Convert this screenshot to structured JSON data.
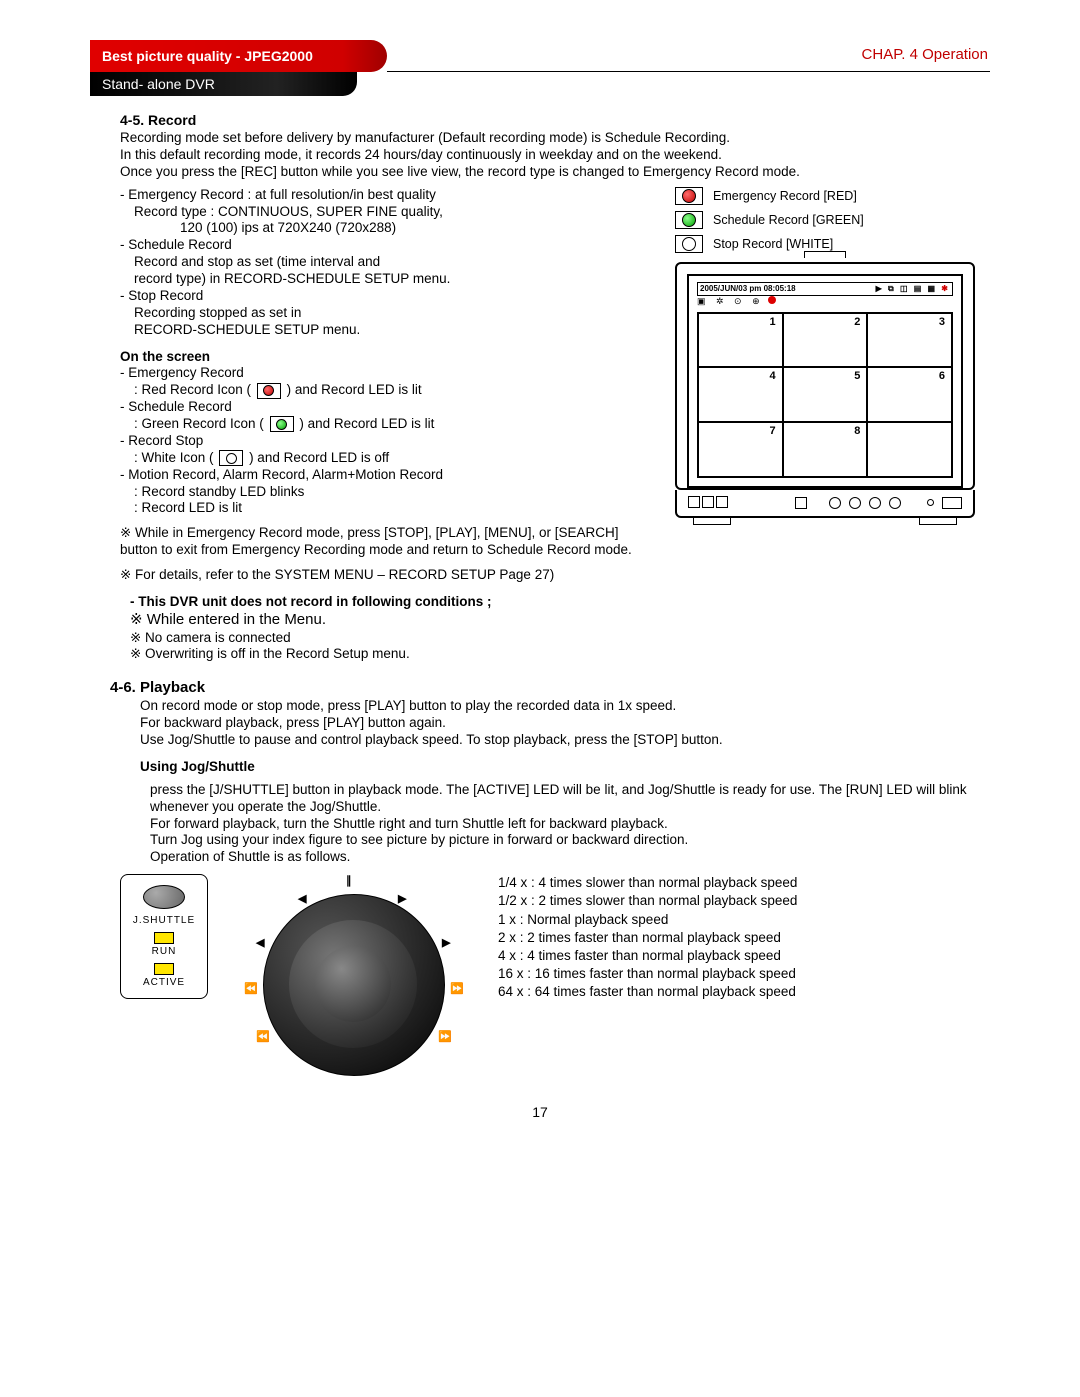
{
  "header": {
    "pill": "Best picture quality - JPEG2000",
    "chapter": "CHAP. 4  Operation",
    "sub": "Stand- alone DVR"
  },
  "s45": {
    "title": "4-5. Record",
    "intro": "Recording mode set before delivery by manufacturer (Default recording mode) is Schedule Recording.\nIn this default recording mode, it records 24 hours/day continuously in weekday and on the weekend.\nOnce you press the [REC] button while you see live view, the record type is changed to Emergency Record mode.",
    "bullets": {
      "b1a": "- Emergency Record : at full resolution/in best quality",
      "b1b": "Record type : CONTINUOUS, SUPER FINE quality,",
      "b1c": "120 (100) ips at 720X240 (720x288)",
      "b2a": "- Schedule Record",
      "b2b": "Record and stop as set (time interval and",
      "b2c": "record type) in RECORD-SCHEDULE SETUP  menu.",
      "b3a": "- Stop Record",
      "b3b": "Recording stopped as set in",
      "b3c": "RECORD-SCHEDULE SETUP menu."
    },
    "onscreen_title": "On the screen",
    "onscreen": {
      "l1": "- Emergency Record",
      "l1b_pre": ": Red Record Icon (",
      "l1b_post": ") and Record LED is lit",
      "l2": "- Schedule Record",
      "l2b_pre": ": Green Record Icon (",
      "l2b_post": ") and Record LED is lit",
      "l3": "- Record Stop",
      "l3b_pre": ": White Icon (",
      "l3b_post": ") and Record LED is off",
      "l4": "- Motion Record, Alarm Record, Alarm+Motion Record",
      "l4b": ": Record standby LED blinks",
      "l4c": ": Record LED is lit",
      "n1": "※ While in Emergency Record mode, press [STOP], [PLAY], [MENU], or [SEARCH] button to exit from Emergency Recording mode and return to Schedule Record mode.",
      "n2": "※ For details, refer to the SYSTEM MENU – RECORD SETUP Page 27)"
    },
    "legend": {
      "red": "Emergency Record [RED]",
      "green": "Schedule Record [GREEN]",
      "white": "Stop Record [WHITE]"
    },
    "osd_time": "2005/JUN/03 pm 08:05:18",
    "grid": [
      "1",
      "2",
      "3",
      "4",
      "5",
      "6",
      "7",
      "8",
      ""
    ],
    "not_record_title": "- This DVR unit does not record in following conditions ;",
    "nr1": "※ While entered in the Menu.",
    "nr2": "※ No camera is connected",
    "nr3": "※ Overwriting is off in the Record Setup menu."
  },
  "s46": {
    "title": "4-6. Playback",
    "intro": "On record mode or stop mode, press [PLAY] button to play the recorded data in 1x speed.\nFor backward playback, press [PLAY] button again.\nUse Jog/Shuttle to pause and control playback speed.  To stop playback, press the [STOP] button.",
    "jog_title": "Using Jog/Shuttle",
    "jog_body": "press the [J/SHUTTLE] button in playback mode. The [ACTIVE] LED will be lit, and Jog/Shuttle is ready for use.  The [RUN] LED will blink whenever you operate the Jog/Shuttle.\nFor forward playback, turn the Shuttle right and turn Shuttle left for backward playback.\nTurn Jog using your index figure to see picture by picture in forward or backward direction.\nOperation of Shuttle is as follows.",
    "jshuttle_label": "J.SHUTTLE",
    "run_label": "RUN",
    "active_label": "ACTIVE",
    "speeds": [
      "1/4 x : 4 times slower than normal playback speed",
      "1/2 x : 2 times slower than normal playback speed",
      "   1 x : Normal playback speed",
      "   2 x : 2 times faster than normal playback speed",
      "   4 x : 4 times faster than normal playback speed",
      " 16 x : 16 times faster than normal playback speed",
      " 64 x : 64 times faster than normal playback speed"
    ]
  },
  "page_number": "17"
}
